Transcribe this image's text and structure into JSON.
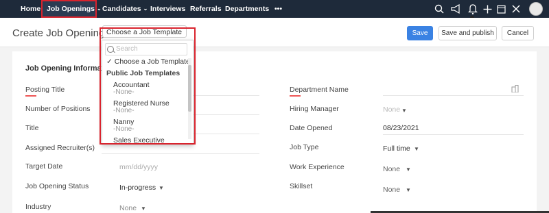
{
  "nav": {
    "items": [
      {
        "label": "Home"
      },
      {
        "label": "Job Openings"
      },
      {
        "label": "Candidates"
      },
      {
        "label": "Interviews"
      },
      {
        "label": "Referrals"
      },
      {
        "label": "Departments"
      },
      {
        "label": "•••"
      }
    ],
    "icons": [
      "search-icon",
      "megaphone-icon",
      "bell-icon",
      "plus-icon",
      "calendar-icon",
      "tools-icon",
      "avatar"
    ],
    "colors": {
      "bar": "#1e2a3a",
      "highlight": "#d9232d"
    }
  },
  "header": {
    "title": "Create Job Opening -",
    "template_select": "Choose a Job Template",
    "save_label": "Save",
    "save_publish_label": "Save and publish",
    "cancel_label": "Cancel",
    "primary_color": "#3a82e3"
  },
  "dropdown": {
    "search_placeholder": "Search",
    "selected": "Choose a Job Template",
    "selected_check": "✓",
    "group_label": "Public Job Templates",
    "items": [
      {
        "label": "Accountant",
        "sub": "-None-"
      },
      {
        "label": "Registered Nurse",
        "sub": "-None-"
      },
      {
        "label": "Nanny",
        "sub": "-None-"
      },
      {
        "label": "Sales Executive",
        "sub": ""
      }
    ]
  },
  "form": {
    "section_title": "Job Opening Information",
    "left_fields": [
      {
        "label": "Posting Title",
        "value": ""
      },
      {
        "label": "Number of Positions",
        "value": ""
      },
      {
        "label": "Title",
        "value": ""
      },
      {
        "label": "Assigned Recruiter(s)",
        "value": ""
      },
      {
        "label": "Target Date",
        "value": "mm/dd/yyyy"
      },
      {
        "label": "Job Opening Status",
        "value": "In-progress"
      },
      {
        "label": "Industry",
        "value": "None"
      }
    ],
    "right_fields": [
      {
        "label": "Department Name",
        "value": ""
      },
      {
        "label": "Hiring Manager",
        "value": "None"
      },
      {
        "label": "Date Opened",
        "value": "08/23/2021"
      },
      {
        "label": "Job Type",
        "value": "Full time"
      },
      {
        "label": "Work Experience",
        "value": "None"
      },
      {
        "label": "Skillset",
        "value": "None"
      }
    ]
  }
}
